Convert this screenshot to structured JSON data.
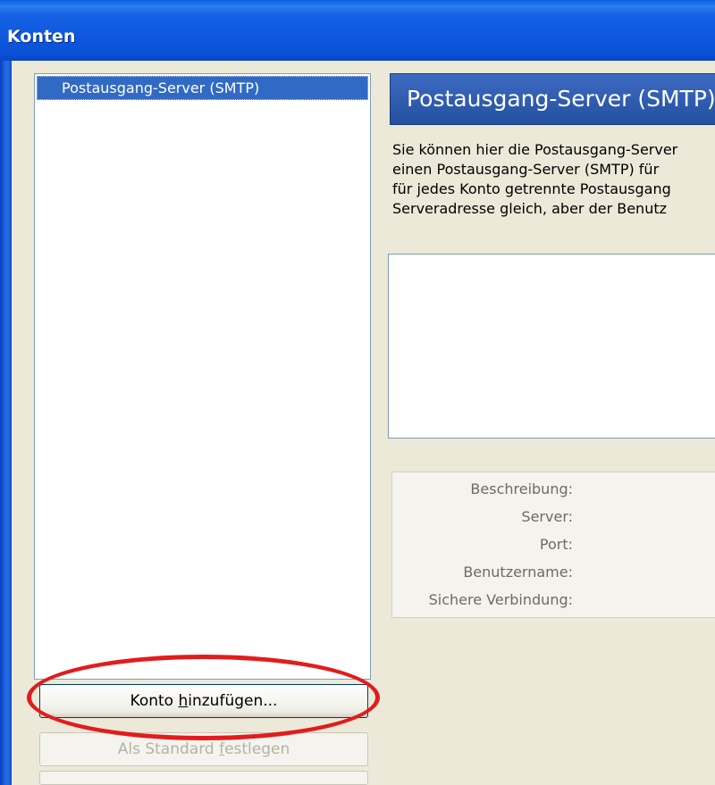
{
  "window": {
    "title": "Konten"
  },
  "accounts_list": {
    "items": [
      {
        "label": "Postausgang-Server (SMTP)"
      }
    ]
  },
  "buttons": {
    "add_account_prefix": "Konto ",
    "add_account_mnemonic": "h",
    "add_account_suffix": "inzufügen...",
    "set_default_prefix": "Als Standard ",
    "set_default_mnemonic": "f",
    "set_default_suffix": "estlegen"
  },
  "smtp_panel": {
    "header": "Postausgang-Server (SMTP)",
    "description_lines": [
      "Sie können hier die Postausgang-Server",
      "einen Postausgang-Server (SMTP) für",
      "für jedes Konto getrennte Postausgang",
      "Serveradresse gleich, aber der Benutz"
    ],
    "detail_labels": {
      "description": "Beschreibung:",
      "server": "Server:",
      "port": "Port:",
      "username": "Benutzername:",
      "secure_connection": "Sichere Verbindung:"
    }
  },
  "colors": {
    "titlebar": "#0a50d6",
    "selection": "#316ac5",
    "header_bg": "#2f5cb0",
    "annotation": "#e21c1c",
    "dialog_bg": "#ece9d8"
  }
}
